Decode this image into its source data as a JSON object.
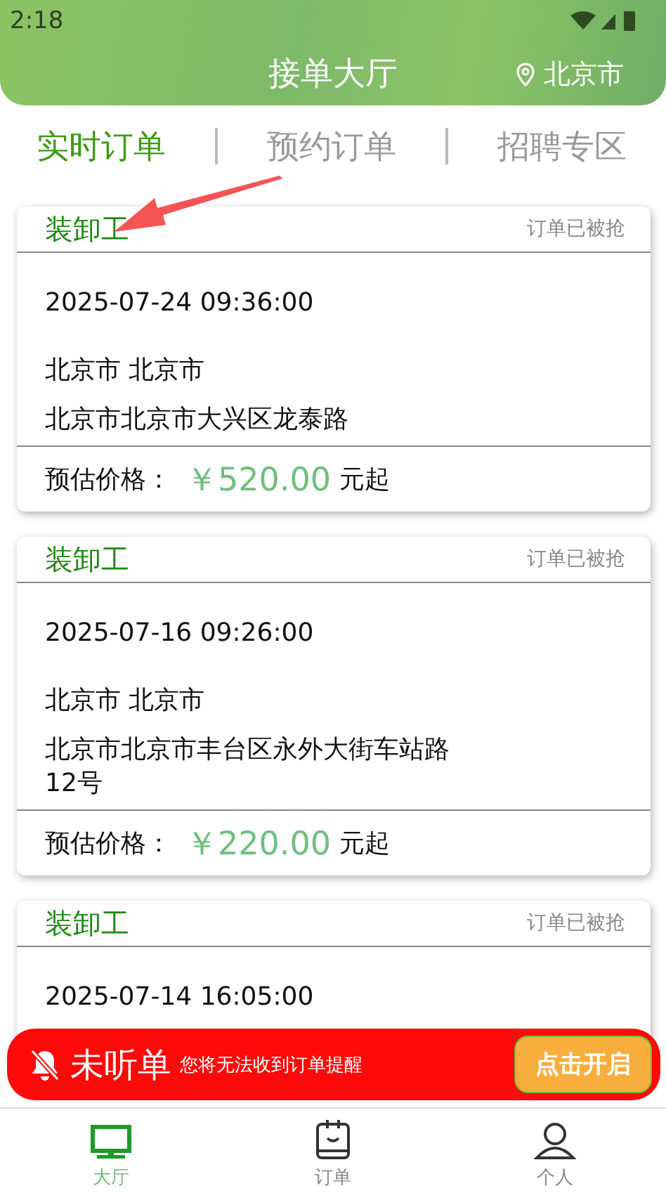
{
  "status_bar": {
    "time": "2:18"
  },
  "header": {
    "title": "接单大厅",
    "location": "北京市"
  },
  "tabs": [
    {
      "label": "实时订单",
      "selected": true
    },
    {
      "label": "预约订单",
      "selected": false
    },
    {
      "label": "招聘专区",
      "selected": false
    }
  ],
  "orders": [
    {
      "title": "装卸工",
      "status": "订单已被抢",
      "time": "2025-07-24 09:36:00",
      "region": "北京市 北京市",
      "address": "北京市北京市大兴区龙泰路",
      "price_label": "预估价格：",
      "price": "￥520.00",
      "price_suffix": "元起"
    },
    {
      "title": "装卸工",
      "status": "订单已被抢",
      "time": "2025-07-16 09:26:00",
      "region": "北京市 北京市",
      "address": "北京市北京市丰台区永外大街车站路12号",
      "price_label": "预估价格：",
      "price": "￥220.00",
      "price_suffix": "元起"
    },
    {
      "title": "装卸工",
      "status": "订单已被抢",
      "time": "2025-07-14 16:05:00"
    }
  ],
  "notice": {
    "title": "未听单",
    "message": "您将无法收到订单提醒",
    "button": "点击开启"
  },
  "bottom_nav": [
    {
      "label": "大厅",
      "kind": "monitor",
      "selected": true
    },
    {
      "label": "订单",
      "kind": "clipboard",
      "selected": false
    },
    {
      "label": "个人",
      "kind": "person",
      "selected": false
    }
  ]
}
